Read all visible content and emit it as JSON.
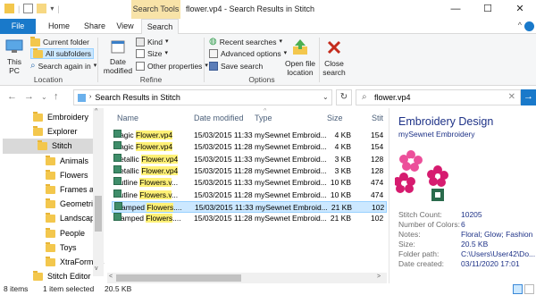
{
  "window": {
    "context_tab": "Search Tools",
    "title": "flower.vp4 - Search Results in Stitch"
  },
  "ribbon_tabs": [
    "File",
    "Home",
    "Share",
    "View",
    "Search"
  ],
  "ribbon": {
    "location": {
      "this_pc": "This PC",
      "current_folder": "Current folder",
      "all_subfolders": "All subfolders",
      "search_again": "Search again in",
      "label": "Location"
    },
    "refine": {
      "date_modified": "Date modified",
      "kind": "Kind",
      "size": "Size",
      "other_properties": "Other properties",
      "label": "Refine"
    },
    "options": {
      "recent_searches": "Recent searches",
      "advanced_options": "Advanced options",
      "save_search": "Save search",
      "open_file_location": "Open file location",
      "label": "Options"
    },
    "close_search": "Close search"
  },
  "address": {
    "path": "Search Results in Stitch",
    "search_value": "flower.vp4"
  },
  "nav_items": [
    {
      "label": "Embroidery",
      "indent": 1
    },
    {
      "label": "Explorer",
      "indent": 1
    },
    {
      "label": "Stitch",
      "indent": 2,
      "selected": true
    },
    {
      "label": "Animals",
      "indent": 3
    },
    {
      "label": "Flowers",
      "indent": 3
    },
    {
      "label": "Frames and",
      "indent": 3
    },
    {
      "label": "Geometric",
      "indent": 3
    },
    {
      "label": "Landscapes",
      "indent": 3
    },
    {
      "label": "People",
      "indent": 3
    },
    {
      "label": "Toys",
      "indent": 3
    },
    {
      "label": "XtraFormats",
      "indent": 3
    },
    {
      "label": "Stitch Editor",
      "indent": 1
    }
  ],
  "columns": [
    "Name",
    "Date modified",
    "Type",
    "Size",
    "Stit"
  ],
  "files": [
    {
      "pre": "Magic ",
      "match": "Flower.vp4",
      "post": "",
      "date": "15/03/2015 11:33",
      "type": "mySewnet Embroid...",
      "size": "4 KB",
      "stit": "154"
    },
    {
      "pre": "Magic ",
      "match": "Flower.vp4",
      "post": "",
      "date": "15/03/2015 11:28",
      "type": "mySewnet Embroid...",
      "size": "4 KB",
      "stit": "154"
    },
    {
      "pre": "Metallic ",
      "match": "Flower.vp4",
      "post": "",
      "date": "15/03/2015 11:33",
      "type": "mySewnet Embroid...",
      "size": "3 KB",
      "stit": "128"
    },
    {
      "pre": "Metallic ",
      "match": "Flower.vp4",
      "post": "",
      "date": "15/03/2015 11:28",
      "type": "mySewnet Embroid...",
      "size": "3 KB",
      "stit": "128"
    },
    {
      "pre": "Outline ",
      "match": "Flowers.v",
      "post": "...",
      "date": "15/03/2015 11:33",
      "type": "mySewnet Embroid...",
      "size": "10 KB",
      "stit": "474"
    },
    {
      "pre": "Outline ",
      "match": "Flowers.v",
      "post": "...",
      "date": "15/03/2015 11:28",
      "type": "mySewnet Embroid...",
      "size": "10 KB",
      "stit": "474"
    },
    {
      "pre": "Stamped ",
      "match": "Flowers",
      "post": "....",
      "date": "15/03/2015 11:33",
      "type": "mySewnet Embroid...",
      "size": "21 KB",
      "stit": "102",
      "selected": true
    },
    {
      "pre": "Stamped ",
      "match": "Flowers",
      "post": "....",
      "date": "15/03/2015 11:28",
      "type": "mySewnet Embroid...",
      "size": "21 KB",
      "stit": "102"
    }
  ],
  "details": {
    "title": "Embroidery Design",
    "subtitle": "mySewnet Embroidery",
    "props": [
      {
        "k": "Stitch Count:",
        "v": "10205"
      },
      {
        "k": "Number of Colors:",
        "v": "6"
      },
      {
        "k": "Notes:",
        "v": "Floral; Glow; Fashion"
      },
      {
        "k": "Size:",
        "v": "20.5 KB"
      },
      {
        "k": "Folder path:",
        "v": "C:\\Users\\User42\\Do..."
      },
      {
        "k": "Date created:",
        "v": "03/11/2020 17:01"
      }
    ]
  },
  "status": {
    "items": "8 items",
    "selected": "1 item selected",
    "size": "20.5 KB"
  },
  "colors": {
    "accent": "#1979ca",
    "highlight": "#fff176",
    "selection": "#cce8ff",
    "context_tab": "#f8e3a8",
    "details_text": "#1e3287",
    "flower_pink": "#ec4f9a"
  }
}
